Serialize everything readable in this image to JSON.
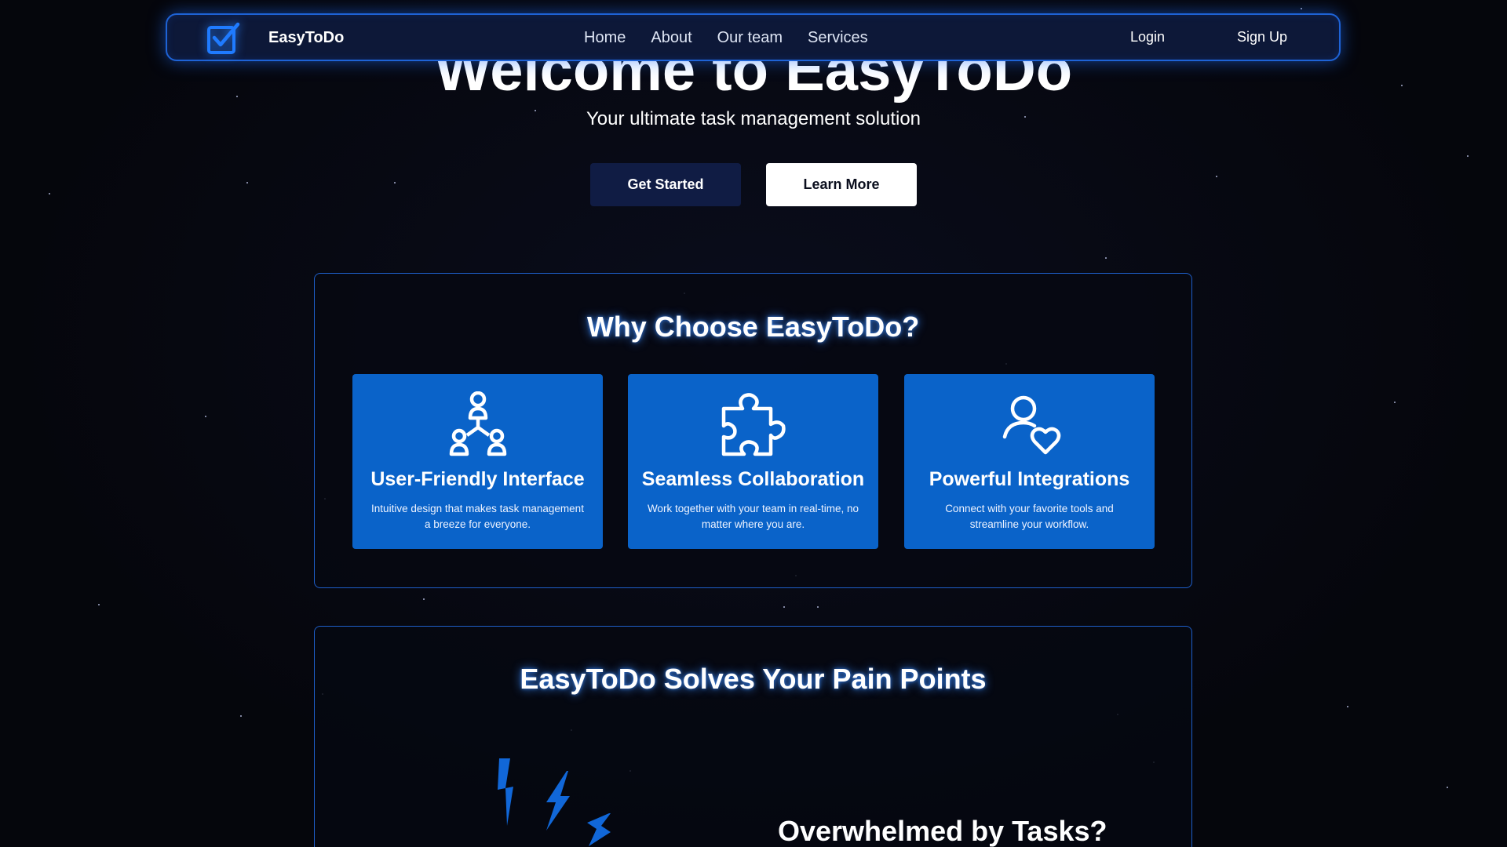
{
  "nav": {
    "brand": "EasyToDo",
    "links": [
      "Home",
      "About",
      "Our team",
      "Services"
    ],
    "login": "Login",
    "signup": "Sign Up"
  },
  "hero": {
    "title": "Welcome to EasyToDo",
    "subtitle": "Your ultimate task management solution",
    "get_started": "Get Started",
    "learn_more": "Learn More"
  },
  "why": {
    "title": "Why Choose EasyToDo?",
    "cards": [
      {
        "icon": "hierarchy-users-icon",
        "title": "User-Friendly Interface",
        "desc": "Intuitive design that makes task management a breeze for everyone."
      },
      {
        "icon": "puzzle-icon",
        "title": "Seamless Collaboration",
        "desc": "Work together with your team in real-time, no matter where you are."
      },
      {
        "icon": "user-heart-icon",
        "title": "Powerful Integrations",
        "desc": "Connect with your favorite tools and streamline your workflow."
      }
    ]
  },
  "pain": {
    "title": "EasyToDo Solves Your Pain Points",
    "heading": "Overwhelmed by Tasks?"
  },
  "colors": {
    "background": "#06070f",
    "accent": "#0a63c9",
    "nav_bg": "#0d1838",
    "border": "#1e5ec9"
  }
}
